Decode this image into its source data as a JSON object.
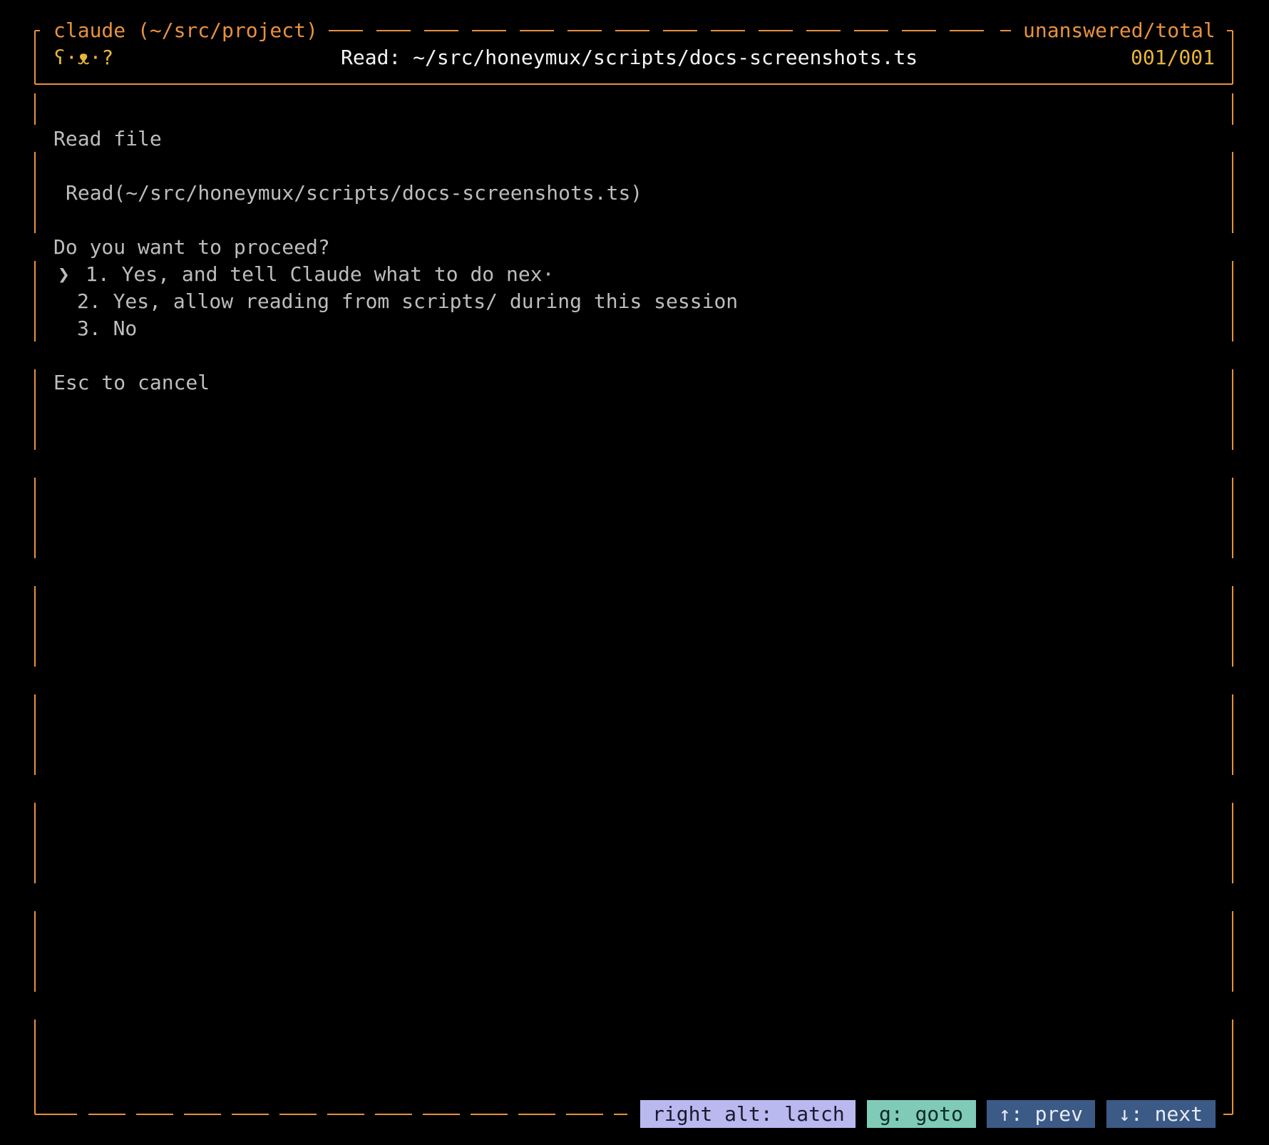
{
  "header": {
    "session_label": "claude (~/src/project)",
    "counter_label": "unanswered/total",
    "mascot": "ʕ·ᴥ·?",
    "title": "Read: ~/src/honeymux/scripts/docs-screenshots.ts",
    "counter_value": "001/001"
  },
  "prompt": {
    "heading": "Read file",
    "command": "Read(~/src/honeymux/scripts/docs-screenshots.ts)",
    "question": "Do you want to proceed?",
    "cursor": "❯",
    "options": [
      {
        "label": "1. Yes, and tell Claude what to do nex·"
      },
      {
        "label": "2. Yes, allow reading from scripts/ during this session"
      },
      {
        "label": "3. No"
      }
    ],
    "hint": "Esc to cancel"
  },
  "footer": {
    "buttons": [
      {
        "label": "right alt: latch"
      },
      {
        "label": "g: goto"
      },
      {
        "label": "↑: prev"
      },
      {
        "label": "↓: next"
      }
    ]
  },
  "colors": {
    "frame": "#e8913f",
    "accent_gold": "#e9b53a",
    "text": "#bdbdbd",
    "background": "#000000"
  }
}
